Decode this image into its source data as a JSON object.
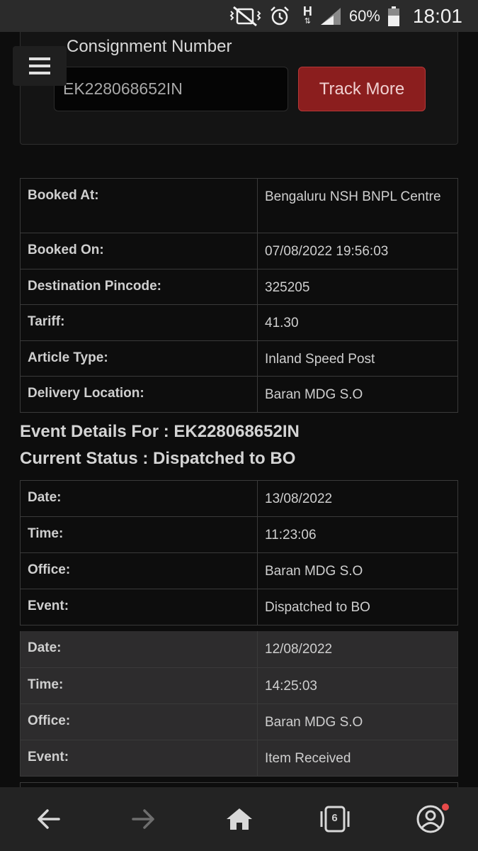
{
  "status_bar": {
    "network_label": "H",
    "battery_percent": "60%",
    "time": "18:01"
  },
  "search": {
    "label": "Consignment Number",
    "input_value": "EK228068652IN",
    "track_button": "Track More"
  },
  "booking": [
    {
      "key": "Booked At:",
      "value": "Bengaluru NSH BNPL Centre"
    },
    {
      "key": "Booked On:",
      "value": "07/08/2022 19:56:03"
    },
    {
      "key": "Destination Pincode:",
      "value": "325205"
    },
    {
      "key": "Tariff:",
      "value": "41.30"
    },
    {
      "key": "Article Type:",
      "value": "Inland Speed Post"
    },
    {
      "key": "Delivery Location:",
      "value": "Baran MDG S.O"
    }
  ],
  "events": {
    "heading": "Event Details For : EK228068652IN",
    "current_status": "Current Status : Dispatched to BO",
    "list": [
      [
        {
          "key": "Date:",
          "value": "13/08/2022"
        },
        {
          "key": "Time:",
          "value": "11:23:06"
        },
        {
          "key": "Office:",
          "value": "Baran MDG S.O"
        },
        {
          "key": "Event:",
          "value": "Dispatched to BO"
        }
      ],
      [
        {
          "key": "Date:",
          "value": "12/08/2022"
        },
        {
          "key": "Time:",
          "value": "14:25:03"
        },
        {
          "key": "Office:",
          "value": "Baran MDG S.O"
        },
        {
          "key": "Event:",
          "value": "Item Received"
        }
      ]
    ]
  },
  "bottom_nav": {
    "tab_count": "6"
  },
  "colors": {
    "accent_button": "#8b1e1e",
    "background": "#0d0d0d",
    "notification_dot": "#e84a4a"
  }
}
